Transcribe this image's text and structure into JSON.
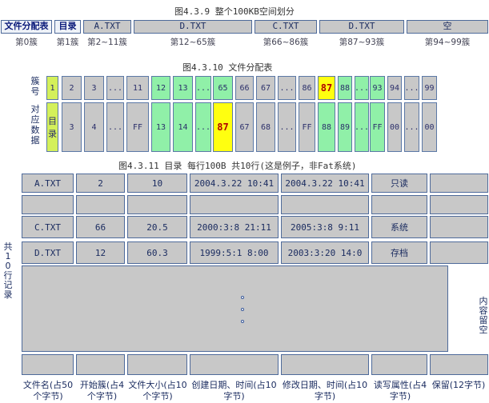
{
  "fig1": {
    "caption": "图4.3.9 整个100KB空间划分",
    "segments": [
      {
        "label": "文件分配表",
        "cluster": "第0簇"
      },
      {
        "label": "目录",
        "cluster": "第1簇"
      },
      {
        "label": "A.TXT",
        "cluster": "第2~11簇"
      },
      {
        "label": "D.TXT",
        "cluster": "第12~65簇"
      },
      {
        "label": "C.TXT",
        "cluster": "第66~86簇"
      },
      {
        "label": "D.TXT",
        "cluster": "第87~93簇"
      },
      {
        "label": "空",
        "cluster": "第94~99簇"
      }
    ]
  },
  "fig2": {
    "caption": "图4.3.10 文件分配表",
    "row1_label": "簇号",
    "row2_label": "对应数据",
    "cells": [
      {
        "num": "1",
        "data": "目录",
        "color": "yellowgreen"
      },
      {
        "num": "2",
        "data": "3",
        "color": "gray"
      },
      {
        "num": "3",
        "data": "4",
        "color": "gray"
      },
      {
        "num": "...",
        "data": "...",
        "color": "gray"
      },
      {
        "num": "11",
        "data": "FF",
        "color": "gray"
      },
      {
        "num": "12",
        "data": "13",
        "color": "green"
      },
      {
        "num": "13",
        "data": "14",
        "color": "green"
      },
      {
        "num": "...",
        "data": "...",
        "color": "green"
      },
      {
        "num": "65",
        "data": "87",
        "color": "green"
      },
      {
        "num": "66",
        "data": "67",
        "color": "gray"
      },
      {
        "num": "67",
        "data": "68",
        "color": "gray"
      },
      {
        "num": "...",
        "data": "...",
        "color": "gray"
      },
      {
        "num": "86",
        "data": "FF",
        "color": "gray"
      },
      {
        "num": "87",
        "data": "88",
        "color": "green"
      },
      {
        "num": "88",
        "data": "89",
        "color": "green"
      },
      {
        "num": "...",
        "data": "...",
        "color": "green"
      },
      {
        "num": "93",
        "data": "FF",
        "color": "green"
      },
      {
        "num": "94",
        "data": "00",
        "color": "gray"
      },
      {
        "num": "...",
        "data": "...",
        "color": "gray"
      },
      {
        "num": "99",
        "data": "00",
        "color": "gray"
      }
    ],
    "highlight_num": "87",
    "highlight_data": "87"
  },
  "fig3": {
    "caption": "图4.3.11  目录 每行100B 共10行(这是例子，非Fat系统)",
    "left_label": "共10行记录",
    "right_label": "内容留空",
    "rows": [
      [
        "A.TXT",
        "2",
        "10",
        "2004.3.22 10:41",
        "2004.3.22 10:41",
        "只读",
        ""
      ],
      [
        "",
        "",
        "",
        "",
        "",
        "",
        ""
      ],
      [
        "C.TXT",
        "66",
        "20.5",
        "2000:3:8 21:11",
        "2005:3:8 9:11",
        "系统",
        ""
      ],
      [
        "D.TXT",
        "12",
        "60.3",
        "1999:5:1 8:00",
        "2003:3:20 14:0",
        "存档",
        ""
      ]
    ],
    "col_captions": [
      "文件名(占50个字节)",
      "开始簇(占4个字节)",
      "文件大小(占10个字节)",
      "创建日期、时间(占10字节)",
      "修改日期、时间(占10字节)",
      "读写属性(占4字节)",
      "保留(12字节)"
    ]
  },
  "colors": {
    "gray": "#c8c8c8",
    "green": "#90f0a8",
    "yellowgreen": "#d4f05a",
    "highlight": "#ffff10",
    "border": "#4e6a9a"
  }
}
